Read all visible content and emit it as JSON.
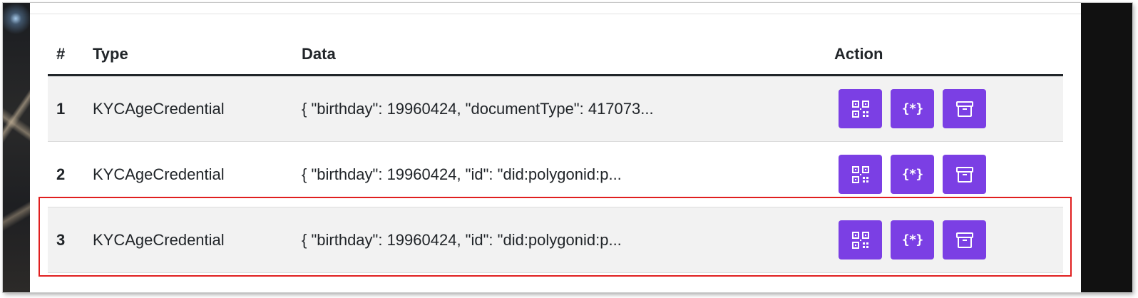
{
  "table": {
    "headers": {
      "num": "#",
      "type": "Type",
      "data": "Data",
      "action": "Action"
    },
    "rows": [
      {
        "num": "1",
        "type": "KYCAgeCredential",
        "data": "{ \"birthday\": 19960424, \"documentType\": 417073..."
      },
      {
        "num": "2",
        "type": "KYCAgeCredential",
        "data": "{ \"birthday\": 19960424, \"id\": \"did:polygonid:p..."
      },
      {
        "num": "3",
        "type": "KYCAgeCredential",
        "data": "{ \"birthday\": 19960424, \"id\": \"did:polygonid:p..."
      }
    ],
    "action_buttons": [
      {
        "icon": "qr-code-icon"
      },
      {
        "icon": "json-braces-icon",
        "glyph": "{*}"
      },
      {
        "icon": "archive-icon"
      }
    ]
  },
  "highlighted_row": "3",
  "colors": {
    "button": "#7b3fe4",
    "highlight": "#e01f1f",
    "row_stripe": "#f2f2f2",
    "text": "#212529"
  }
}
